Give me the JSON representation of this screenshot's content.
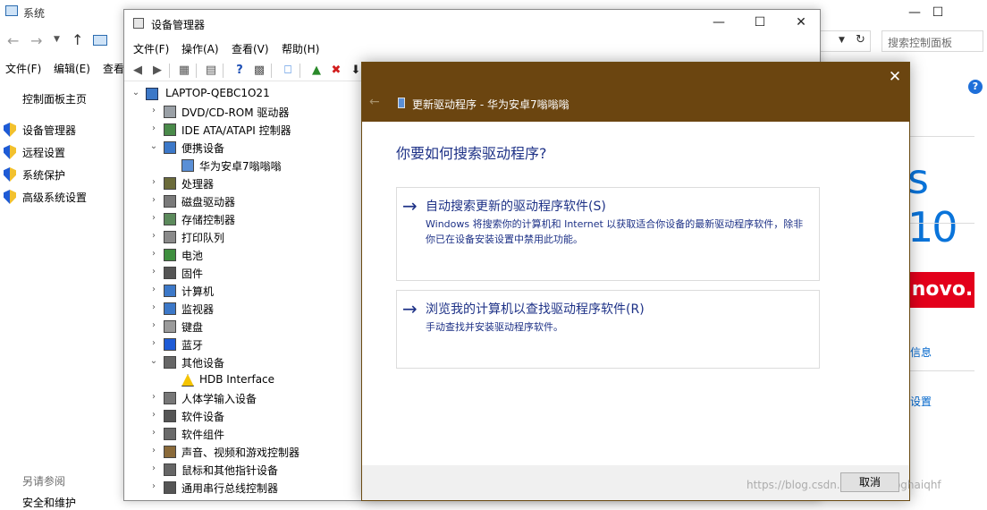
{
  "system_window": {
    "title": "系统",
    "search_placeholder": "搜索控制面板",
    "menu": [
      "文件(F)",
      "编辑(E)",
      "查看"
    ],
    "nav_home": "控制面板主页",
    "nav_items": [
      "设备管理器",
      "远程设置",
      "系统保护",
      "高级系统设置"
    ],
    "see_also": "另请参阅",
    "see_also_item": "安全和维护",
    "help": "?",
    "right_text_win10": "s 10",
    "right_brand": "novo.",
    "right_link_info": "信息",
    "right_link_change": "设置"
  },
  "device_manager": {
    "title": "设备管理器",
    "menu": [
      "文件(F)",
      "操作(A)",
      "查看(V)",
      "帮助(H)"
    ],
    "computer": "LAPTOP-QEBC1O21",
    "tree": [
      {
        "label": "DVD/CD-ROM 驱动器",
        "expanded": false,
        "icon": "disc-drive-icon"
      },
      {
        "label": "IDE ATA/ATAPI 控制器",
        "expanded": false,
        "icon": "ide-controller-icon"
      },
      {
        "label": "便携设备",
        "expanded": true,
        "icon": "portable-device-icon"
      },
      {
        "label": "华为安卓7嗡嗡嗡",
        "child": true,
        "icon": "phone-icon"
      },
      {
        "label": "处理器",
        "expanded": false,
        "icon": "processor-icon"
      },
      {
        "label": "磁盘驱动器",
        "expanded": false,
        "icon": "disk-drive-icon"
      },
      {
        "label": "存储控制器",
        "expanded": false,
        "icon": "storage-controller-icon"
      },
      {
        "label": "打印队列",
        "expanded": false,
        "icon": "printer-icon"
      },
      {
        "label": "电池",
        "expanded": false,
        "icon": "battery-icon"
      },
      {
        "label": "固件",
        "expanded": false,
        "icon": "firmware-icon"
      },
      {
        "label": "计算机",
        "expanded": false,
        "icon": "computer-icon"
      },
      {
        "label": "监视器",
        "expanded": false,
        "icon": "monitor-icon"
      },
      {
        "label": "键盘",
        "expanded": false,
        "icon": "keyboard-icon"
      },
      {
        "label": "蓝牙",
        "expanded": false,
        "icon": "bluetooth-icon"
      },
      {
        "label": "其他设备",
        "expanded": true,
        "icon": "other-devices-icon"
      },
      {
        "label": "HDB Interface",
        "child": true,
        "icon": "warning-device-icon"
      },
      {
        "label": "人体学输入设备",
        "expanded": false,
        "icon": "hid-icon"
      },
      {
        "label": "软件设备",
        "expanded": false,
        "icon": "software-device-icon"
      },
      {
        "label": "软件组件",
        "expanded": false,
        "icon": "software-component-icon"
      },
      {
        "label": "声音、视频和游戏控制器",
        "expanded": false,
        "icon": "sound-icon"
      },
      {
        "label": "鼠标和其他指针设备",
        "expanded": false,
        "icon": "mouse-icon"
      },
      {
        "label": "通用串行总线控制器",
        "expanded": false,
        "icon": "usb-icon"
      }
    ]
  },
  "update_driver": {
    "title": "更新驱动程序 - 华为安卓7嗡嗡嗡",
    "question": "你要如何搜索驱动程序?",
    "option1_title": "自动搜索更新的驱动程序软件(S)",
    "option1_desc": "Windows 将搜索你的计算机和 Internet 以获取适合你设备的最新驱动程序软件，除非你已在设备安装设置中禁用此功能。",
    "option2_title": "浏览我的计算机以查找驱动程序软件(R)",
    "option2_desc": "手动查找并安装驱动程序软件。",
    "cancel": "取消",
    "watermark": "https://blog.csdn.net/haiqiaoghaiqhf"
  },
  "colors": {
    "dialog_header": "#6b4510",
    "link_blue": "#1e3287",
    "accent": "#0a74da"
  }
}
